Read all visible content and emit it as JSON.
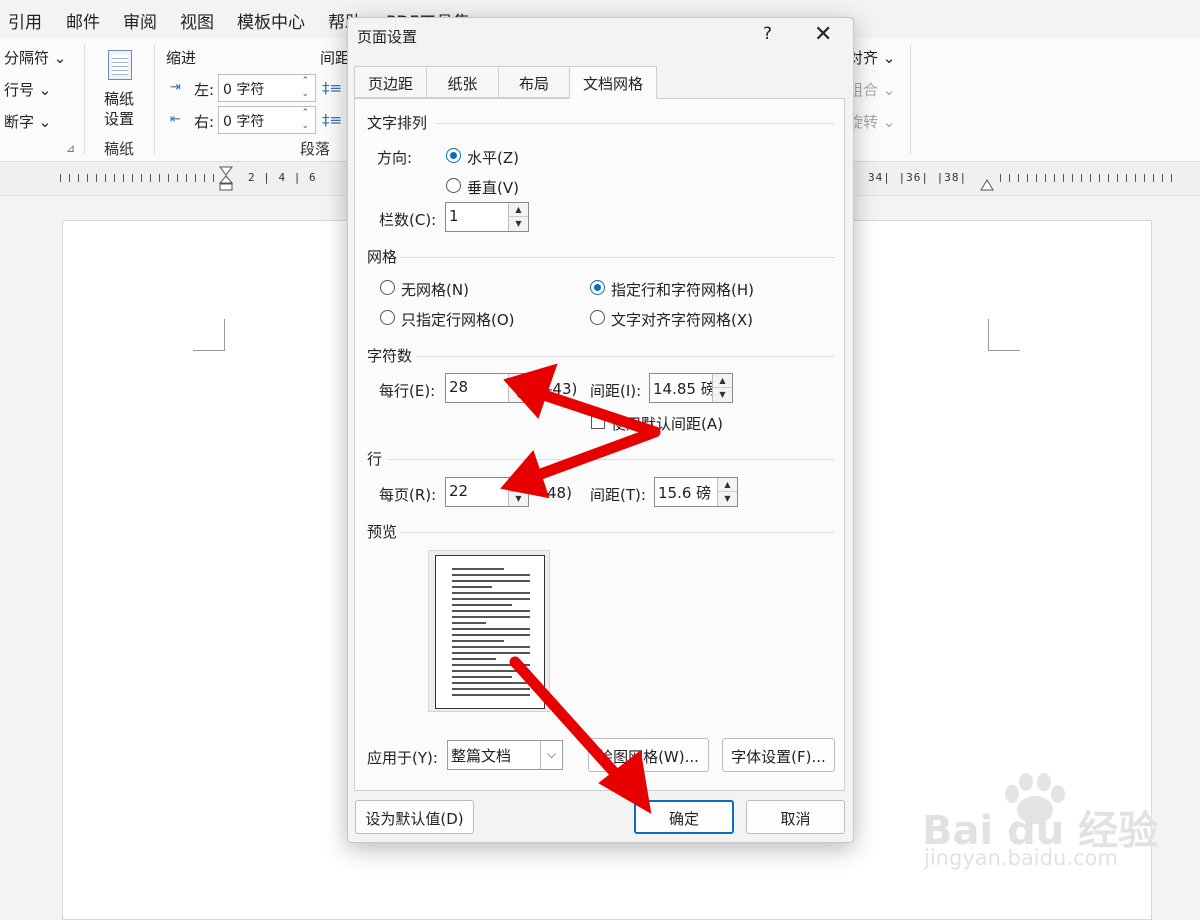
{
  "menu": {
    "items": [
      "引用",
      "邮件",
      "审阅",
      "视图",
      "模板中心",
      "帮助",
      "PDF工具集"
    ]
  },
  "ribbon": {
    "left_items": [
      "分隔符 ⌄",
      "行号 ⌄",
      "断字 ⌄"
    ],
    "paper_button": {
      "line1": "稿纸",
      "line2": "设置"
    },
    "paper_group": "稿纸",
    "indent_label": "缩进",
    "indent_left_label": "左:",
    "indent_right_label": "右:",
    "indent_left_value": "0 字符",
    "indent_right_value": "0 字符",
    "spacing_label": "间距",
    "paragraph_group": "段落",
    "right_items": [
      "对齐 ⌄",
      "组合 ⌄",
      "旋转 ⌄"
    ]
  },
  "ruler": {
    "left_ticks": "2  |  4  |  6",
    "right_ticks": "34|  |36|  |38|"
  },
  "dialog": {
    "title": "页面设置",
    "help": "?",
    "close": "✕",
    "tabs": [
      {
        "label": "页边距",
        "active": false
      },
      {
        "label": "纸张",
        "active": false
      },
      {
        "label": "布局",
        "active": false
      },
      {
        "label": "文档网格",
        "active": true
      }
    ],
    "text_arrangement": {
      "section": "文字排列",
      "direction_label": "方向:",
      "horizontal": "水平(Z)",
      "vertical": "垂直(V)",
      "columns_label": "栏数(C):",
      "columns_value": "1"
    },
    "grid": {
      "section": "网格",
      "options": [
        "无网格(N)",
        "指定行和字符网格(H)",
        "只指定行网格(O)",
        "文字对齐字符网格(X)"
      ],
      "selected": "指定行和字符网格(H)"
    },
    "chars": {
      "section": "字符数",
      "per_line_label": "每行(E):",
      "per_line_value": "28",
      "range": "-43)",
      "pitch_label": "间距(I):",
      "pitch_value": "14.85 磅",
      "default_pitch_label": "使用默认间距(A)"
    },
    "lines": {
      "section": "行",
      "per_page_label": "每页(R):",
      "per_page_value": "22",
      "range": "48)",
      "pitch_label": "间距(T):",
      "pitch_value": "15.6 磅"
    },
    "preview": {
      "section": "预览"
    },
    "apply_label": "应用于(Y):",
    "apply_value": "整篇文档",
    "draw_grid_button": "绘图网格(W)...",
    "font_settings_button": "字体设置(F)...",
    "set_default_button": "设为默认值(D)",
    "ok_button": "确定",
    "cancel_button": "取消"
  },
  "watermark": {
    "logo": "Bai  du 经验",
    "url": "jingyan.baidu.com"
  },
  "colors": {
    "accent": "#0f6cbd",
    "arrow": "#e60000"
  }
}
